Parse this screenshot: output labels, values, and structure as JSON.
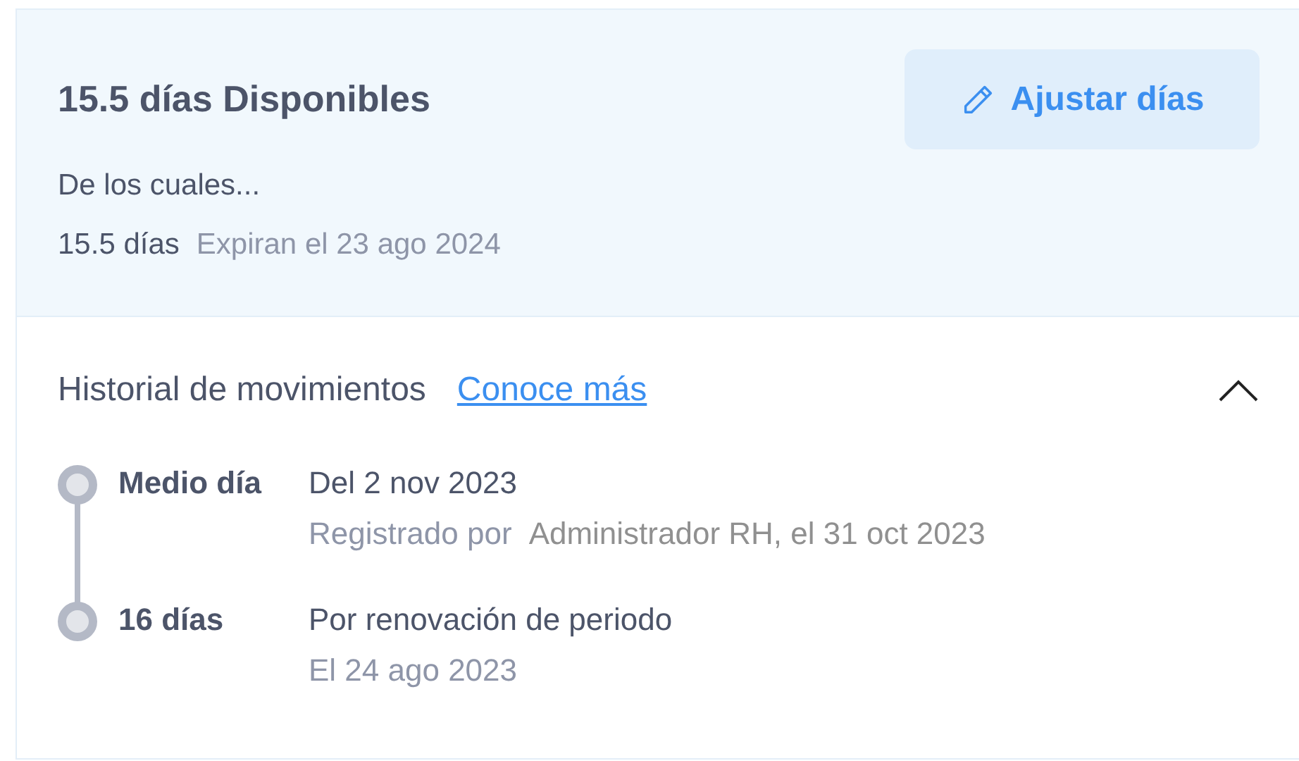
{
  "summary": {
    "title": "15.5 días Disponibles",
    "subtitle": "De los cuales...",
    "breakdown": [
      {
        "amount": "15.5 días",
        "note": "Expiran el 23 ago 2024"
      }
    ]
  },
  "adjust_button": {
    "label": "Ajustar días"
  },
  "history": {
    "title": "Historial de movimientos",
    "link": "Conoce más",
    "expanded": true,
    "entries": [
      {
        "kind": "registered",
        "amount": "Medio día",
        "description": "Del 2 nov 2023",
        "meta_label": "Registrado por",
        "meta_value": "Administrador RH, el 31 oct 2023"
      },
      {
        "kind": "dated",
        "amount": "16 días",
        "description": "Por renovación de periodo",
        "meta_value": "El 24 ago 2023"
      }
    ]
  }
}
